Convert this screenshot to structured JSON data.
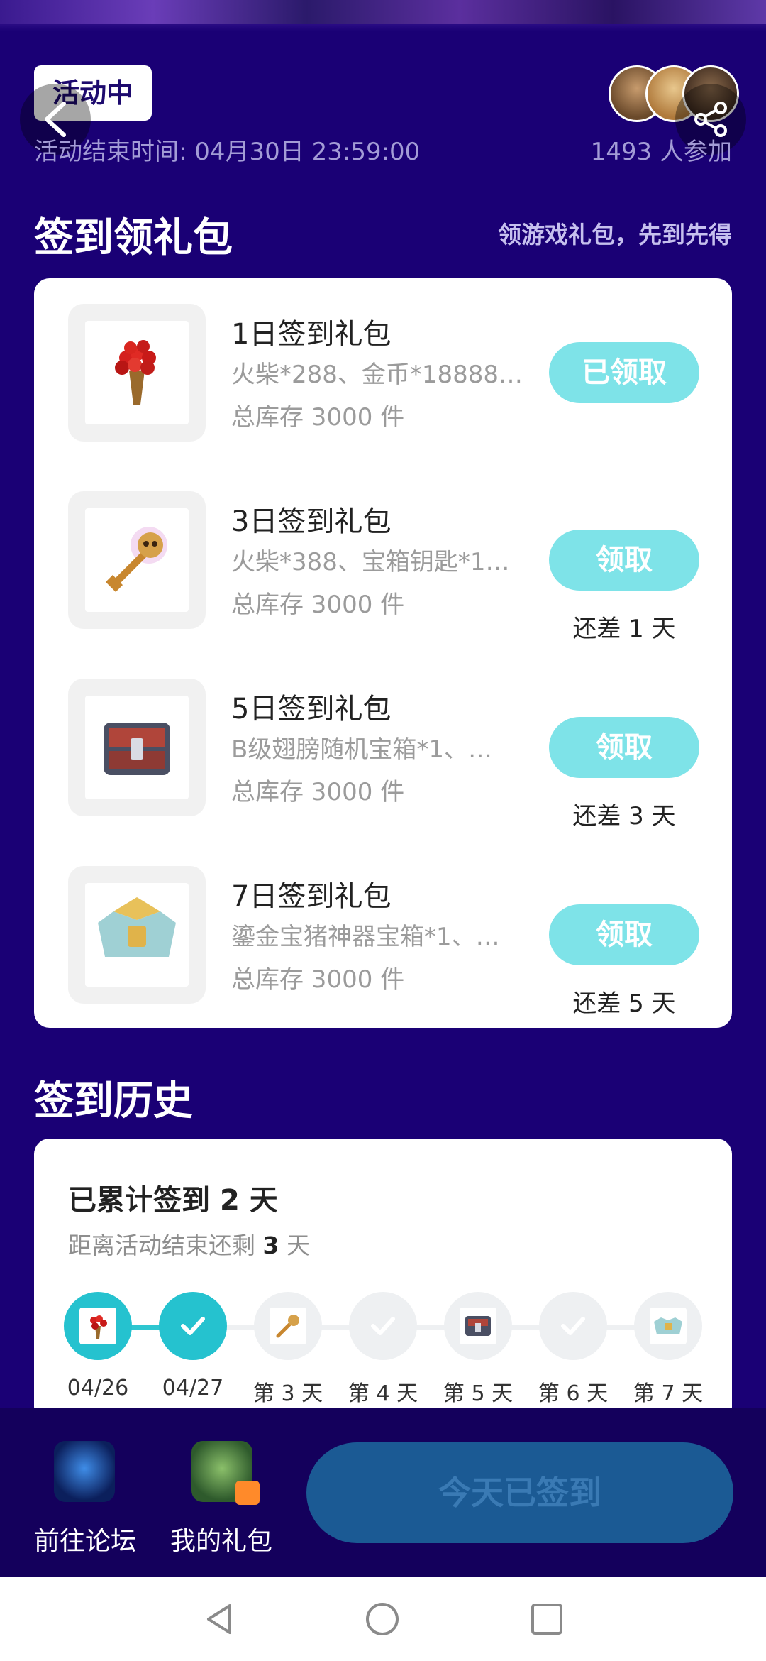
{
  "header": {
    "status_badge": "活动中",
    "end_time": "活动结束时间: 04月30日 23:59:00",
    "participants": "1493 人参加"
  },
  "gifts_section": {
    "title": "签到领礼包",
    "subtitle": "领游戏礼包，先到先得",
    "items": [
      {
        "name": "1日签到礼包",
        "contents": "火柴*288、金币*18888…",
        "stock": "总库存 3000 件",
        "button": "已领取",
        "days_left": "",
        "icon": "red-flower-bouquet-icon"
      },
      {
        "name": "3日签到礼包",
        "contents": "火柴*388、宝箱钥匙*1…",
        "stock": "总库存 3000 件",
        "button": "领取",
        "days_left": "还差 1 天",
        "icon": "skull-key-icon"
      },
      {
        "name": "5日签到礼包",
        "contents": "B级翅膀随机宝箱*1、…",
        "stock": "总库存 3000 件",
        "button": "领取",
        "days_left": "还差 3 天",
        "icon": "treasure-chest-icon"
      },
      {
        "name": "7日签到礼包",
        "contents": "鎏金宝猪神器宝箱*1、…",
        "stock": "总库存 3000 件",
        "button": "领取",
        "days_left": "还差 5 天",
        "icon": "golden-chest-icon"
      }
    ]
  },
  "history_section": {
    "title": "签到历史",
    "accum_prefix": "已累计签到",
    "accum_days": "2",
    "accum_suffix": "天",
    "remain_prefix": "距离活动结束还剩",
    "remain_days": "3",
    "remain_suffix": "天",
    "days": [
      {
        "label": "04/26",
        "state": "done"
      },
      {
        "label": "04/27",
        "state": "done"
      },
      {
        "label": "第 3 天",
        "state": "pending"
      },
      {
        "label": "第 4 天",
        "state": "pending"
      },
      {
        "label": "第 5 天",
        "state": "pending"
      },
      {
        "label": "第 6 天",
        "state": "pending"
      },
      {
        "label": "第 7 天",
        "state": "pending"
      }
    ]
  },
  "bottom_bar": {
    "forum_label": "前往论坛",
    "gifts_label": "我的礼包",
    "checkin_button": "今天已签到"
  },
  "colors": {
    "background": "#1a0075",
    "accent_teal": "#25c2cf",
    "button_light": "#7ee3e8"
  }
}
